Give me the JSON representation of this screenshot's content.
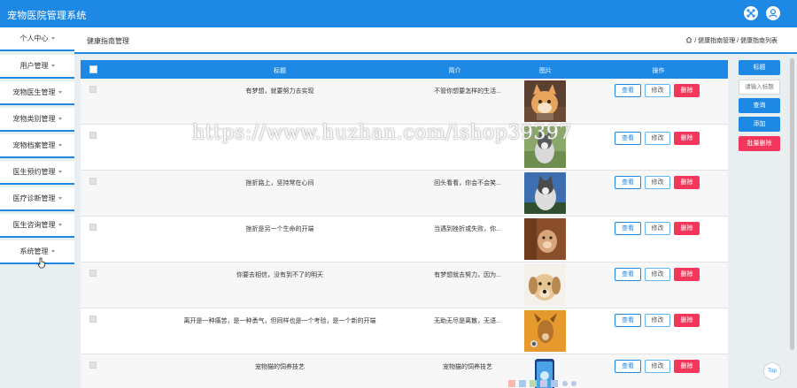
{
  "app": {
    "title": "宠物医院管理系统"
  },
  "top_icons": {
    "fullscreen": "fullscreen-icon",
    "user": "user-icon"
  },
  "sidebar": {
    "items": [
      {
        "label": "个人中心"
      },
      {
        "label": "用户管理"
      },
      {
        "label": "宠物医生管理"
      },
      {
        "label": "宠物类别管理"
      },
      {
        "label": "宠物档案管理"
      },
      {
        "label": "医生预约管理"
      },
      {
        "label": "医疗诊断管理"
      },
      {
        "label": "医生咨询管理"
      },
      {
        "label": "系统管理"
      }
    ]
  },
  "header": {
    "page_title": "健康指南管理",
    "breadcrumb": [
      "健康指南管理",
      "健康指南列表"
    ],
    "sep": "/"
  },
  "table": {
    "headers": {
      "title": "标题",
      "intro": "简介",
      "image": "图片",
      "action": "操作"
    },
    "rows": [
      {
        "title": "有梦想，就要努力去实现",
        "intro": "不管你想要怎样的生活...",
        "image": "cat"
      },
      {
        "title": "",
        "intro": "",
        "image": "husky-grass"
      },
      {
        "title": "挫折路上，坚持常在心间",
        "intro": "回头看看，你会不会笑...",
        "image": "husky-sky"
      },
      {
        "title": "挫折是另一个生命的开端",
        "intro": "当遇到挫折或失败，你...",
        "image": "brown-dog"
      },
      {
        "title": "你要去相信，没有到不了的明天",
        "intro": "有梦想就去努力，因为...",
        "image": "puppy"
      },
      {
        "title": "离开是一种痛苦，是一种勇气，但同样也是一个考验，是一个新的开端",
        "intro": "无助无尽是离散，无语...",
        "image": "dog-orange"
      },
      {
        "title": "宠物猫的饲养技艺",
        "intro": "宠物猫的饲养技艺",
        "image": "cat-phone"
      }
    ],
    "buttons": {
      "view": "查看",
      "edit": "修改",
      "delete": "删除"
    }
  },
  "right_panel": {
    "title_label": "标题",
    "input_placeholder": "请输入标题",
    "query": "查询",
    "add": "添加",
    "batch_delete": "批量删除"
  },
  "back_to_top": "Top",
  "watermark": "https://www.huzhan.com/ishop39397",
  "colors": {
    "accent": "#1e88e5",
    "danger": "#f5365c",
    "sidebar_bg": "#e6efed"
  }
}
